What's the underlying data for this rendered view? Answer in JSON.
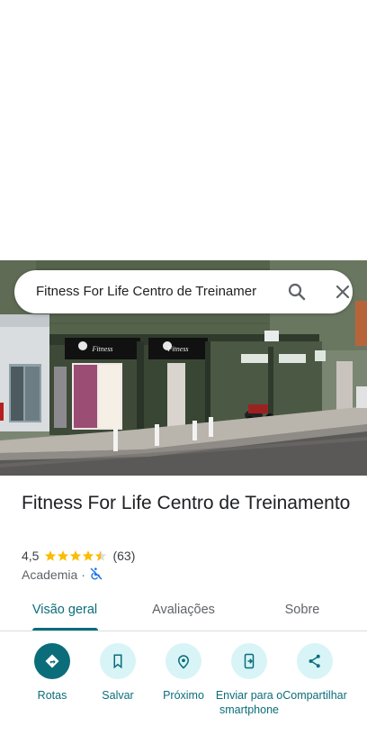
{
  "search": {
    "query": "Fitness For Life Centro de Treinamer",
    "search_icon": "search-icon",
    "close_icon": "close-icon"
  },
  "place": {
    "name": "Fitness For Life Centro de Treinamento",
    "rating": "4,5",
    "stars": 4.5,
    "review_count": "(63)",
    "category": "Academia",
    "separator": "·",
    "accessibility_icon": "not-accessible-icon"
  },
  "tabs": [
    {
      "label": "Visão geral",
      "active": true
    },
    {
      "label": "Avaliações",
      "active": false
    },
    {
      "label": "Sobre",
      "active": false
    }
  ],
  "actions": [
    {
      "label": "Rotas",
      "icon": "directions-icon"
    },
    {
      "label": "Salvar",
      "icon": "bookmark-icon"
    },
    {
      "label": "Próximo",
      "icon": "nearby-icon"
    },
    {
      "label": "Enviar para o smartphone",
      "icon": "send-to-phone-icon"
    },
    {
      "label": "Compartilhar",
      "icon": "share-icon"
    }
  ],
  "colors": {
    "accent": "#0b6d7a",
    "accent_light": "#d8f4f7",
    "star": "#fbbc04"
  }
}
